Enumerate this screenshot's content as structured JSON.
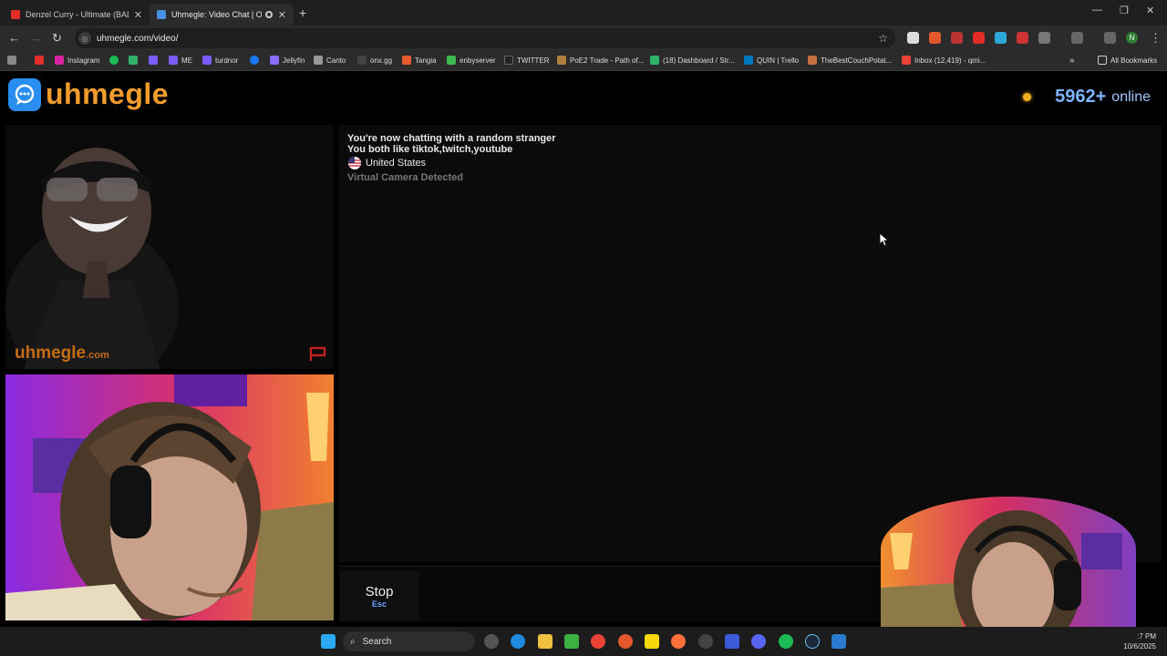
{
  "browser": {
    "tabs": [
      {
        "title": "Denzel Curry - Ultimate (BADB...",
        "favicon_color": "#e52d27"
      },
      {
        "title": "Uhmegle: Video Chat | Om...",
        "favicon_color": "#4a90e2"
      }
    ],
    "new_tab": "+",
    "url": "uhmegle.com/video/",
    "bookmarks": [
      {
        "label": "",
        "color": "#e52d27"
      },
      {
        "label": "Instagram",
        "color": "#d6249f"
      },
      {
        "label": "",
        "color": "#1db954"
      },
      {
        "label": "",
        "color": "#2fb36b"
      },
      {
        "label": "",
        "color": "#7b5cff"
      },
      {
        "label": "ME",
        "color": "#7b5cff"
      },
      {
        "label": "turdnor",
        "color": "#7b5cff"
      },
      {
        "label": "",
        "color": "#1877f2"
      },
      {
        "label": "Jellyfin",
        "color": "#8a6cff"
      },
      {
        "label": "Canto",
        "color": "#999999"
      },
      {
        "label": "onx.gg",
        "color": "#444444"
      },
      {
        "label": "Tangia",
        "color": "#e85a2a"
      },
      {
        "label": "enbyserver",
        "color": "#3fb950"
      },
      {
        "label": "TWITTER",
        "color": "#222222"
      },
      {
        "label": "PoE2 Trade - Path of...",
        "color": "#b08040"
      },
      {
        "label": "(18) Dashboard / Str...",
        "color": "#2fb36b"
      },
      {
        "label": "QUIN | Trello",
        "color": "#0079bf"
      },
      {
        "label": "TheBestCouchPotat...",
        "color": "#c87040"
      },
      {
        "label": "Inbox (12,419) - qmi...",
        "color": "#ea4335"
      }
    ],
    "all_bookmarks": "All Bookmarks",
    "profile_initial": "N"
  },
  "site": {
    "logo": "uhmegle",
    "online_count": "5962+",
    "online_label": "online",
    "watermark": "uhmegle",
    "watermark_tld": ".com"
  },
  "chat": {
    "line1": "You're now chatting with a random stranger",
    "line2": "You both like tiktok,twitch,youtube",
    "country": "United States",
    "virtual": "Virtual Camera Detected"
  },
  "controls": {
    "stop": "Stop",
    "stop_key": "Esc"
  },
  "taskbar": {
    "search": "Search",
    "time": ":7 PM",
    "date": "10/6/2025"
  }
}
